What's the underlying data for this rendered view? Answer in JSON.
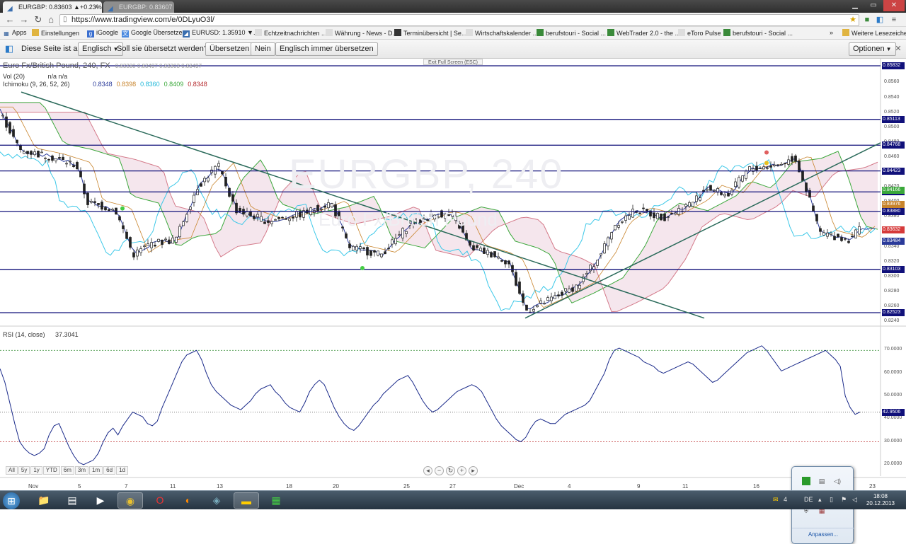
{
  "browser": {
    "tabs": [
      {
        "label": "EURGBP: 0.83603 ▲+0.23%",
        "active": true
      },
      {
        "label": "EURGBP: 0.83607 ▲+0.2...",
        "active": false
      }
    ],
    "url": "https://www.tradingview.com/e/0DLyuO3l/",
    "bookmarks": [
      {
        "label": "Apps",
        "icon": "apps-grid-icon"
      },
      {
        "label": "Einstellungen",
        "icon": "folder-icon"
      },
      {
        "label": "iGoogle",
        "icon": "google-icon"
      },
      {
        "label": "Google Übersetzer",
        "icon": "translate-icon"
      },
      {
        "label": "EURUSD: 1.35910 ▼...",
        "icon": "tradingview-icon"
      },
      {
        "label": "Echtzeitnachrichten ...",
        "icon": "page-icon"
      },
      {
        "label": "Währung - News - D...",
        "icon": "page-icon"
      },
      {
        "label": "Terminübersicht | Se...",
        "icon": "page-icon"
      },
      {
        "label": "Wirtschaftskalender ...",
        "icon": "page-icon"
      },
      {
        "label": "berufstouri - Social ...",
        "icon": "page-icon"
      },
      {
        "label": "WebTrader 2.0 - the ...",
        "icon": "page-icon"
      },
      {
        "label": "eToro Pulse",
        "icon": "page-icon"
      },
      {
        "label": "berufstouri - Social ...",
        "icon": "page-icon"
      },
      {
        "label": "Weitere Lesezeichen",
        "icon": "folder-icon"
      }
    ]
  },
  "translate_bar": {
    "prefix": "Diese Seite ist auf",
    "language": "Englisch",
    "question": "Soll sie übersetzt werden?",
    "translate_btn": "Übersetzen",
    "no_btn": "Nein",
    "always_btn": "Englisch immer übersetzen",
    "options_btn": "Optionen"
  },
  "chart": {
    "exit_fullscreen": "Exit Full Screen (ESC)",
    "symbol_title": "Euro Fx/British Pound, 240, FX",
    "ohlc": "0.83330  0.83497  0.83303  0.83497",
    "watermark": "EURGBP, 240",
    "watermark_sub": "Euro Fx/British Pound",
    "vol_label": "Vol (20)",
    "vol_values": "n/a  n/a",
    "ichimoku_label": "Ichimoku (9, 26, 52, 26)",
    "ichimoku_values": [
      {
        "value": "0.8348",
        "color": "#2a3a9a"
      },
      {
        "value": "0.8398",
        "color": "#c8842c"
      },
      {
        "value": "0.8360",
        "color": "#1fb7d8"
      },
      {
        "value": "0.8409",
        "color": "#3aa83a"
      },
      {
        "value": "0.8348",
        "color": "#b4282c"
      }
    ],
    "price_axis_labels": [
      "0.8560",
      "0.8540",
      "0.8520",
      "0.8500",
      "0.8480",
      "0.8460",
      "0.8440",
      "0.8420",
      "0.8400",
      "0.8380",
      "0.8360",
      "0.8340",
      "0.8320",
      "0.8300",
      "0.8280",
      "0.8260",
      "0.8240"
    ],
    "horizontal_lines": [
      {
        "price": "0.85832",
        "color": "#10107a"
      },
      {
        "price": "0.85113",
        "color": "#10107a"
      },
      {
        "price": "0.84768",
        "color": "#10107a"
      },
      {
        "price": "0.84423",
        "color": "#10107a"
      },
      {
        "price": "0.84142",
        "color": "#10107a"
      },
      {
        "price": "0.83880",
        "color": "#10107a"
      },
      {
        "price": "0.83103",
        "color": "#10107a"
      },
      {
        "price": "0.82523",
        "color": "#10107a"
      }
    ],
    "badges": [
      {
        "price": "0.84166",
        "color": "#3aa83a"
      },
      {
        "price": "0.83976",
        "color": "#c8842c"
      },
      {
        "price": "0.83632",
        "color": "#d63a3a"
      },
      {
        "price": "0.83484",
        "color": "#2a3a9a"
      }
    ],
    "x_axis_labels": [
      "Nov",
      "5",
      "7",
      "11",
      "13",
      "18",
      "20",
      "25",
      "27",
      "Dec",
      "4",
      "9",
      "11",
      "16",
      "18",
      "23"
    ],
    "timeframes": [
      "All",
      "5y",
      "1y",
      "YTD",
      "6m",
      "3m",
      "1m",
      "6d",
      "1d"
    ]
  },
  "rsi": {
    "label": "RSI (14, close)",
    "value": "37.3041",
    "axis_labels": [
      "70.0000",
      "60.0000",
      "50.0000",
      "40.0000",
      "30.0000",
      "20.0000"
    ],
    "current_badge": "42.9506",
    "upper": 70,
    "lower": 30,
    "values": [
      62,
      56,
      47,
      38,
      30,
      27,
      25,
      24,
      25,
      27,
      33,
      37,
      38,
      33,
      28,
      24,
      21,
      20,
      21,
      22,
      25,
      30,
      34,
      36,
      33,
      37,
      40,
      43,
      42,
      41,
      38,
      37,
      39,
      45,
      50,
      55,
      60,
      65,
      68,
      69,
      70,
      66,
      60,
      55,
      52,
      50,
      48,
      46,
      45,
      44,
      46,
      48,
      51,
      53,
      54,
      55,
      52,
      50,
      47,
      45,
      44,
      43,
      47,
      52,
      55,
      57,
      55,
      50,
      45,
      41,
      38,
      36,
      35,
      37,
      40,
      43,
      46,
      48,
      51,
      53,
      55,
      57,
      58,
      59,
      56,
      52,
      48,
      45,
      43,
      44,
      46,
      48,
      50,
      52,
      53,
      54,
      55,
      54,
      52,
      48,
      44,
      40,
      37,
      35,
      33,
      31,
      30,
      32,
      36,
      39,
      40,
      39,
      38,
      38,
      40,
      42,
      43,
      44,
      45,
      46,
      48,
      52,
      56,
      60,
      66,
      70,
      71,
      70,
      69,
      68,
      67,
      65,
      64,
      63,
      61,
      60,
      61,
      62,
      63,
      64,
      65,
      64,
      62,
      60,
      58,
      56,
      57,
      59,
      61,
      63,
      65,
      67,
      69,
      70,
      71,
      72,
      70,
      67,
      64,
      61,
      62,
      63,
      64,
      65,
      66,
      67,
      68,
      69,
      70,
      68,
      66,
      63,
      50,
      45,
      42,
      43
    ]
  },
  "tray_popup": {
    "link": "Anpassen..."
  },
  "taskbar": {
    "lang": "DE",
    "time": "18:08",
    "date": "20.12.2013"
  }
}
